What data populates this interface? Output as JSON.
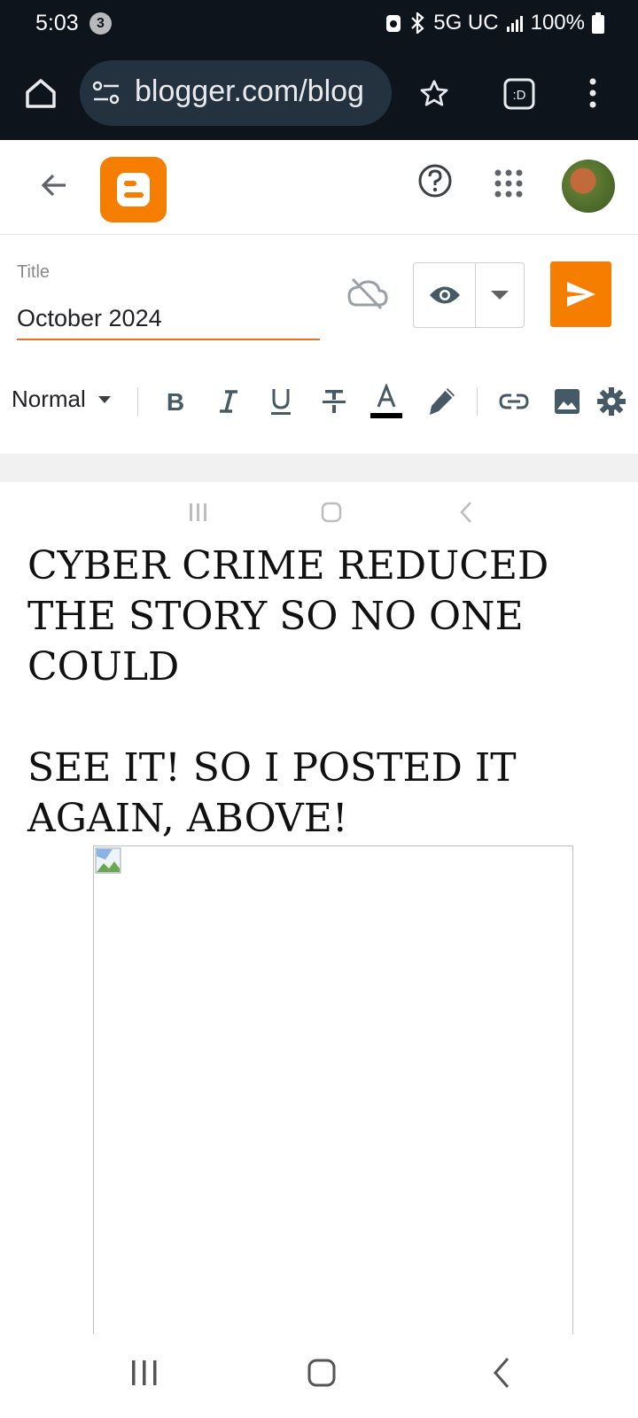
{
  "status_bar": {
    "time": "5:03",
    "notification_count": "3",
    "network": "5G UC",
    "battery": "100%"
  },
  "browser": {
    "url": "blogger.com/blog"
  },
  "editor": {
    "title_label": "Title",
    "title_value": "October 2024",
    "format_label": "Normal",
    "body_text": "CYBER CRIME REDUCED THE STORY SO NO ONE COULD\n\nSEE IT! SO I POSTED IT AGAIN, ABOVE!"
  },
  "colors": {
    "brand": "#f57d00",
    "status_bg": "#0d141c",
    "title_underline": "#e8711a"
  }
}
